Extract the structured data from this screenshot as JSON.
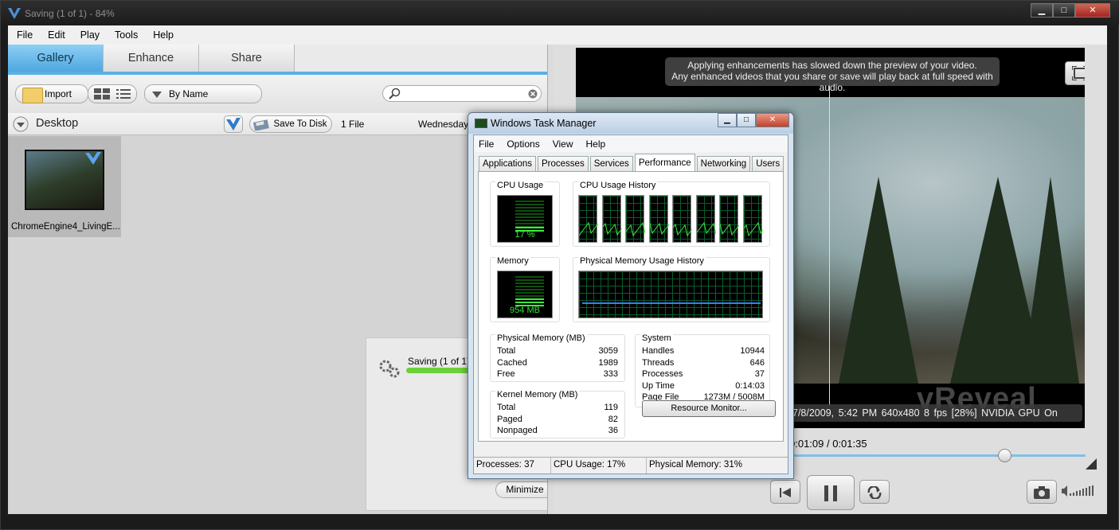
{
  "window": {
    "title": "Saving (1 of 1) - 84%",
    "min": "▁",
    "max": "□",
    "close": "✕"
  },
  "menu": [
    "File",
    "Edit",
    "Play",
    "Tools",
    "Help"
  ],
  "tabs": [
    "Gallery",
    "Enhance",
    "Share"
  ],
  "toolbar": {
    "import": "Import",
    "sort": "By Name",
    "search_placeholder": ""
  },
  "folderbar": {
    "location": "Desktop",
    "save_to_disk": "Save To Disk",
    "file_count": "1 File",
    "date": "Wednesday,"
  },
  "gallery_items": [
    {
      "label": "ChromeEngine4_LivingE..."
    }
  ],
  "saving": {
    "text": "Saving (1 of 1)",
    "progress": 0.84,
    "minimize": "Minimize"
  },
  "preview": {
    "notice_line1": "Applying enhancements has slowed down the preview of your video.",
    "notice_line2": "Any enhanced videos that you share or save will play back at full speed with audio.",
    "info": "7/8/2009, 5:42 PM   640x480   8 fps [28%]   NVIDIA GPU On",
    "watermark": "vReveal",
    "timecode": "0:01:09 / 0:01:35",
    "position": 0.726
  },
  "taskmanager": {
    "title": "Windows Task Manager",
    "menu": [
      "File",
      "Options",
      "View",
      "Help"
    ],
    "tabs": [
      "Applications",
      "Processes",
      "Services",
      "Performance",
      "Networking",
      "Users"
    ],
    "active_tab": "Performance",
    "cpu_usage_label": "CPU Usage",
    "cpu_usage_value": "17 %",
    "cpu_percent": 17,
    "cpu_history_label": "CPU Usage History",
    "memory_label": "Memory",
    "memory_value": "954 MB",
    "memory_percent": 31,
    "phys_history_label": "Physical Memory Usage History",
    "physical_memory": {
      "title": "Physical Memory (MB)",
      "rows": [
        {
          "k": "Total",
          "v": "3059"
        },
        {
          "k": "Cached",
          "v": "1989"
        },
        {
          "k": "Free",
          "v": "333"
        }
      ]
    },
    "kernel_memory": {
      "title": "Kernel Memory (MB)",
      "rows": [
        {
          "k": "Total",
          "v": "119"
        },
        {
          "k": "Paged",
          "v": "82"
        },
        {
          "k": "Nonpaged",
          "v": "36"
        }
      ]
    },
    "system": {
      "title": "System",
      "rows": [
        {
          "k": "Handles",
          "v": "10944"
        },
        {
          "k": "Threads",
          "v": "646"
        },
        {
          "k": "Processes",
          "v": "37"
        },
        {
          "k": "Up Time",
          "v": "0:14:03"
        },
        {
          "k": "Page File",
          "v": "1273M / 5008M"
        }
      ]
    },
    "resource_monitor": "Resource Monitor...",
    "status": {
      "processes": "Processes: 37",
      "cpu": "CPU Usage: 17%",
      "memory": "Physical Memory: 31%"
    }
  }
}
